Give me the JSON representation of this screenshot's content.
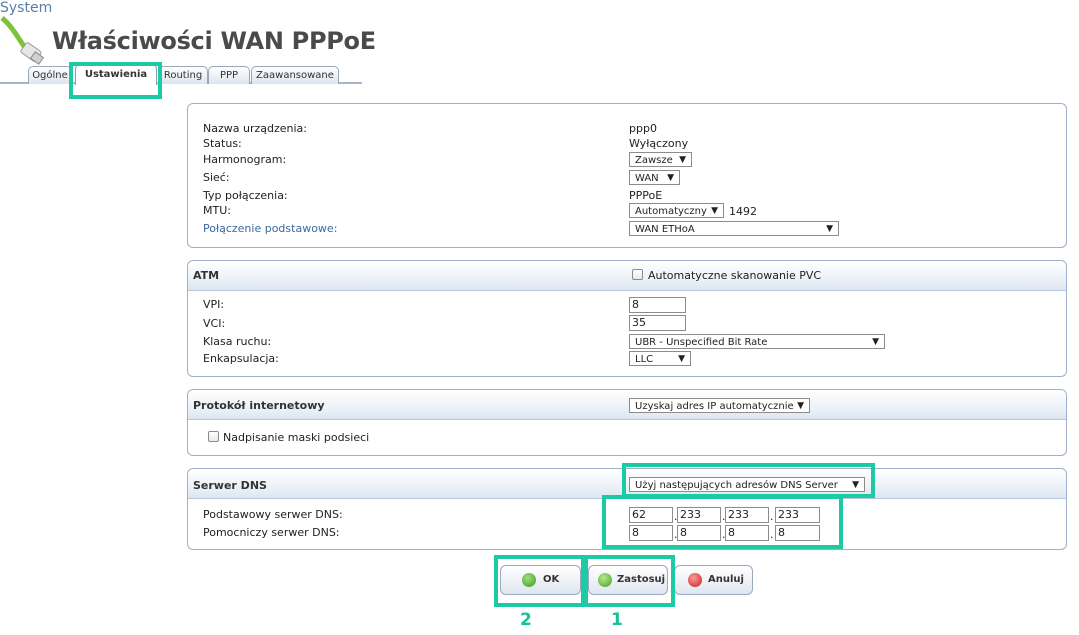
{
  "header": {
    "breadcrumb": "System",
    "title": "Właściwości WAN PPPoE",
    "tabs": [
      "Ogólne",
      "Ustawienia",
      "Routing",
      "PPP",
      "Zaawansowane"
    ]
  },
  "general": {
    "device_name_label": "Nazwa urządzenia:",
    "device_name_value": "ppp0",
    "status_label": "Status:",
    "status_value": "Wyłączony",
    "schedule_label": "Harmonogram:",
    "schedule_value": "Zawsze",
    "network_label": "Sieć:",
    "network_value": "WAN",
    "conn_type_label": "Typ połączenia:",
    "conn_type_value": "PPPoE",
    "mtu_label": "MTU:",
    "mtu_mode": "Automatyczny",
    "mtu_value": "1492",
    "base_conn_label": "Połączenie podstawowe:",
    "base_conn_value": "WAN ETHoA"
  },
  "atm": {
    "title": "ATM",
    "auto_scan_label": "Automatyczne skanowanie PVC",
    "vpi_label": "VPI:",
    "vpi_value": "8",
    "vci_label": "VCI:",
    "vci_value": "35",
    "traffic_class_label": "Klasa ruchu:",
    "traffic_class_value": "UBR - Unspecified Bit Rate",
    "encapsulation_label": "Enkapsulacja:",
    "encapsulation_value": "LLC"
  },
  "ip": {
    "title": "Protokół internetowy",
    "mode_value": "Uzyskaj adres IP automatycznie",
    "override_mask_label": "Nadpisanie maski podsieci"
  },
  "dns": {
    "title": "Serwer DNS",
    "mode_value": "Użyj następujących adresów DNS Server",
    "primary_label": "Podstawowy serwer DNS:",
    "primary": [
      "62",
      "233",
      "233",
      "233"
    ],
    "secondary_label": "Pomocniczy serwer DNS:",
    "secondary": [
      "8",
      "8",
      "8",
      "8"
    ]
  },
  "buttons": {
    "ok": "OK",
    "apply": "Zastosuj",
    "cancel": "Anuluj"
  },
  "annotations": {
    "step1": "1",
    "step2": "2",
    "color": "#1ccaa3"
  }
}
